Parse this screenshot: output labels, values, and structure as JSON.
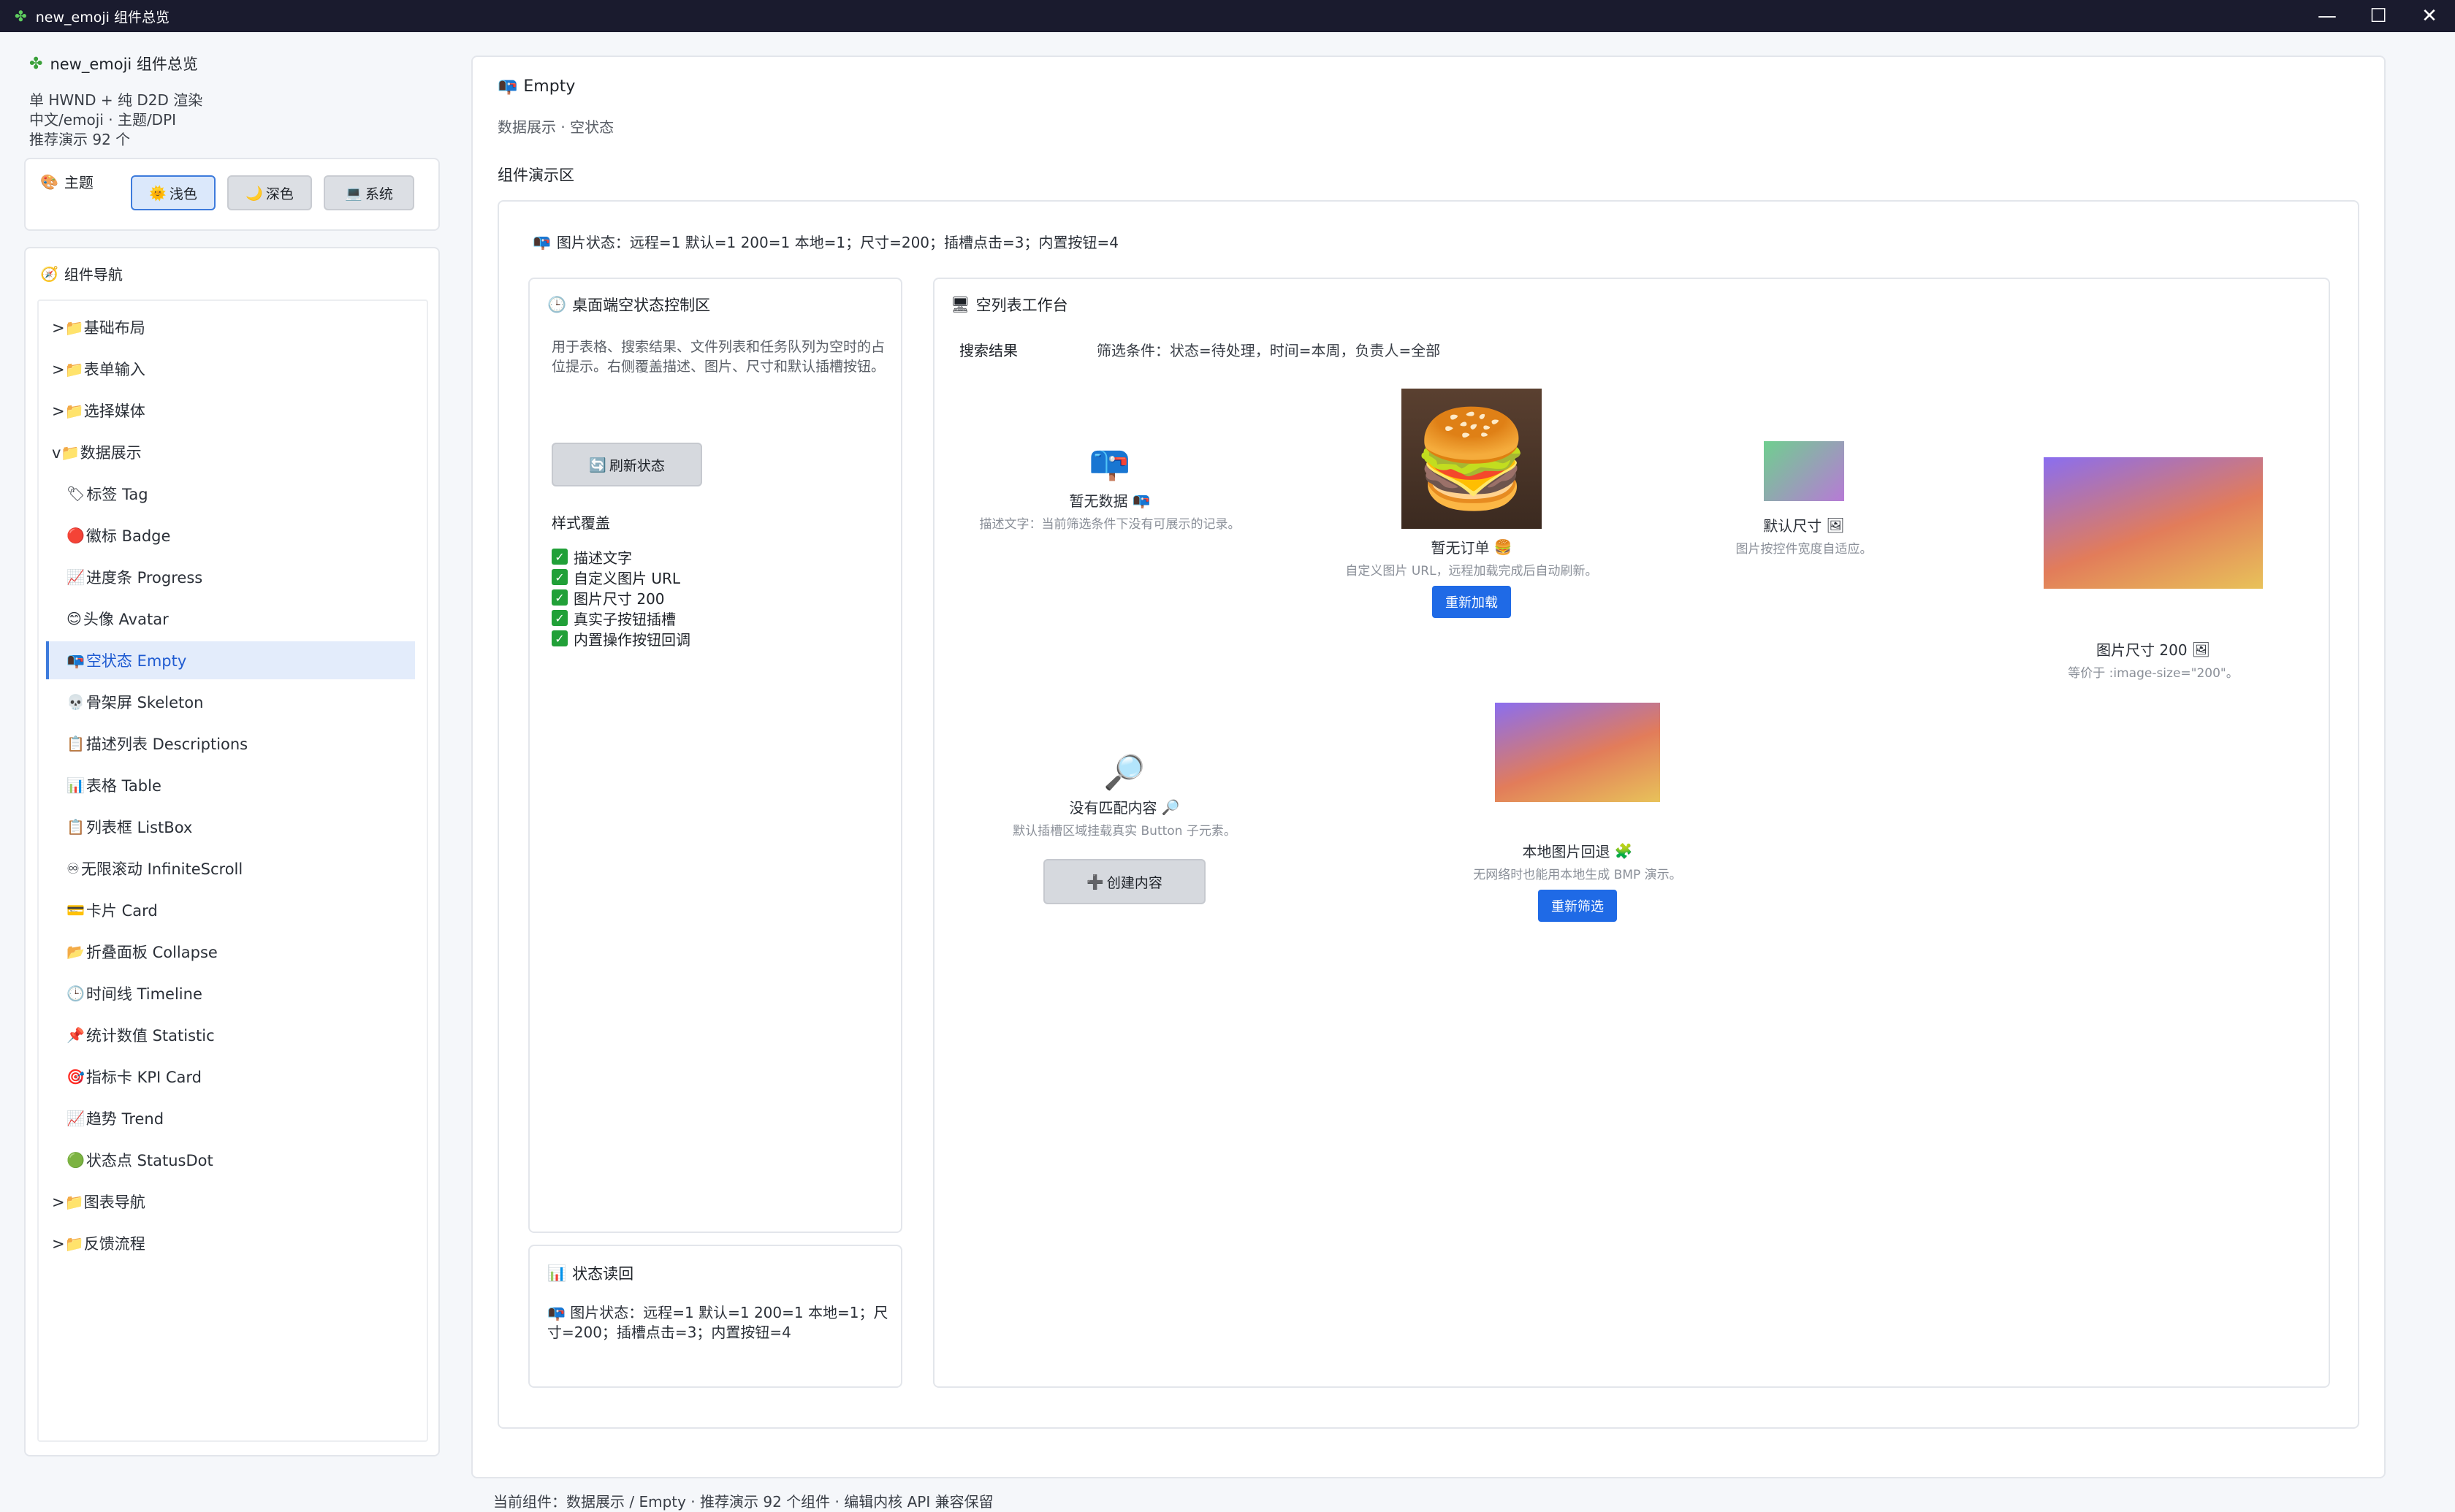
{
  "window": {
    "title": "new_emoji 组件总览"
  },
  "sidebar": {
    "app_name": "new_emoji 组件总览",
    "meta": [
      "单 HWND + 纯 D2D 渲染",
      "中文/emoji · 主题/DPI",
      "推荐演示 92 个"
    ],
    "theme": {
      "label": "主题",
      "buttons": [
        {
          "icon": "🌞",
          "label": "浅色",
          "active": true
        },
        {
          "icon": "🌙",
          "label": "深色",
          "active": false
        },
        {
          "icon": "💻",
          "label": "系统",
          "active": false
        }
      ]
    },
    "nav_title": "组件导航",
    "groups_before": [
      {
        "label": ">📁基础布局"
      },
      {
        "label": ">📁表单输入"
      },
      {
        "label": ">📁选择媒体"
      },
      {
        "label": "v📁数据展示"
      }
    ],
    "children": [
      {
        "icon": "🏷",
        "label": "标签 Tag"
      },
      {
        "icon": "🔴",
        "label": "徽标 Badge"
      },
      {
        "icon": "📈",
        "label": "进度条 Progress"
      },
      {
        "icon": "😊",
        "label": "头像 Avatar"
      },
      {
        "icon": "📭",
        "label": "空状态 Empty"
      },
      {
        "icon": "💀",
        "label": "骨架屏 Skeleton"
      },
      {
        "icon": "📋",
        "label": "描述列表 Descriptions"
      },
      {
        "icon": "📊",
        "label": "表格 Table"
      },
      {
        "icon": "📋",
        "label": "列表框 ListBox"
      },
      {
        "icon": "♾",
        "label": "无限滚动 InfiniteScroll"
      },
      {
        "icon": "💳",
        "label": "卡片 Card"
      },
      {
        "icon": "📂",
        "label": "折叠面板 Collapse"
      },
      {
        "icon": "🕒",
        "label": "时间线 Timeline"
      },
      {
        "icon": "📌",
        "label": "统计数值 Statistic"
      },
      {
        "icon": "🎯",
        "label": "指标卡 KPI Card"
      },
      {
        "icon": "📈",
        "label": "趋势 Trend"
      },
      {
        "icon": "🟢",
        "label": "状态点 StatusDot"
      }
    ],
    "groups_after": [
      {
        "label": ">📁图表导航"
      },
      {
        "label": ">📁反馈流程"
      }
    ]
  },
  "main": {
    "title": "Empty",
    "subtitle": "数据展示 · 空状态",
    "demo_label": "组件演示区",
    "status_line": "图片状态：远程=1 默认=1 200=1 本地=1；尺寸=200；插槽点击=3；内置按钮=4",
    "control": {
      "title": "桌面端空状态控制区",
      "description": "用于表格、搜索结果、文件列表和任务队列为空时的占位提示。右侧覆盖描述、图片、尺寸和默认插槽按钮。",
      "refresh_label": "刷新状态",
      "style_label": "样式覆盖",
      "checks": [
        "描述文字",
        "自定义图片 URL",
        "图片尺寸 200",
        "真实子按钮插槽",
        "内置操作按钮回调"
      ]
    },
    "readback": {
      "title": "状态读回",
      "text": "图片状态：远程=1 默认=1 200=1 本地=1；尺寸=200；插槽点击=3；内置按钮=4"
    },
    "workbench": {
      "title": "空列表工作台",
      "row_label": "搜索结果",
      "filter": "筛选条件：状态=待处理，时间=本周，负责人=全部",
      "items": [
        {
          "name": "暂无数据",
          "name_icon": "📭",
          "sub": "描述文字：当前筛选条件下没有可展示的记录。"
        },
        {
          "name": "暂无订单",
          "name_icon": "🍔",
          "sub": "自定义图片 URL，远程加载完成后自动刷新。",
          "button": "重新加载"
        },
        {
          "name": "默认尺寸",
          "name_icon": "🖼",
          "sub": "图片按控件宽度自适应。"
        },
        {
          "name": "图片尺寸 200",
          "name_icon": "🖼",
          "sub": "等价于 :image-size=\"200\"。"
        },
        {
          "name": "没有匹配内容",
          "name_icon": "🔎",
          "sub": "默认插槽区域挂载真实 Button 子元素。",
          "button": "创建内容"
        },
        {
          "name": "本地图片回退",
          "name_icon": "🧩",
          "sub": "无网络时也能用本地生成 BMP 演示。",
          "button": "重新筛选"
        }
      ]
    }
  },
  "footer": "当前组件：数据展示 / Empty · 推荐演示 92 个组件 · 编辑内核 API 兼容保留"
}
